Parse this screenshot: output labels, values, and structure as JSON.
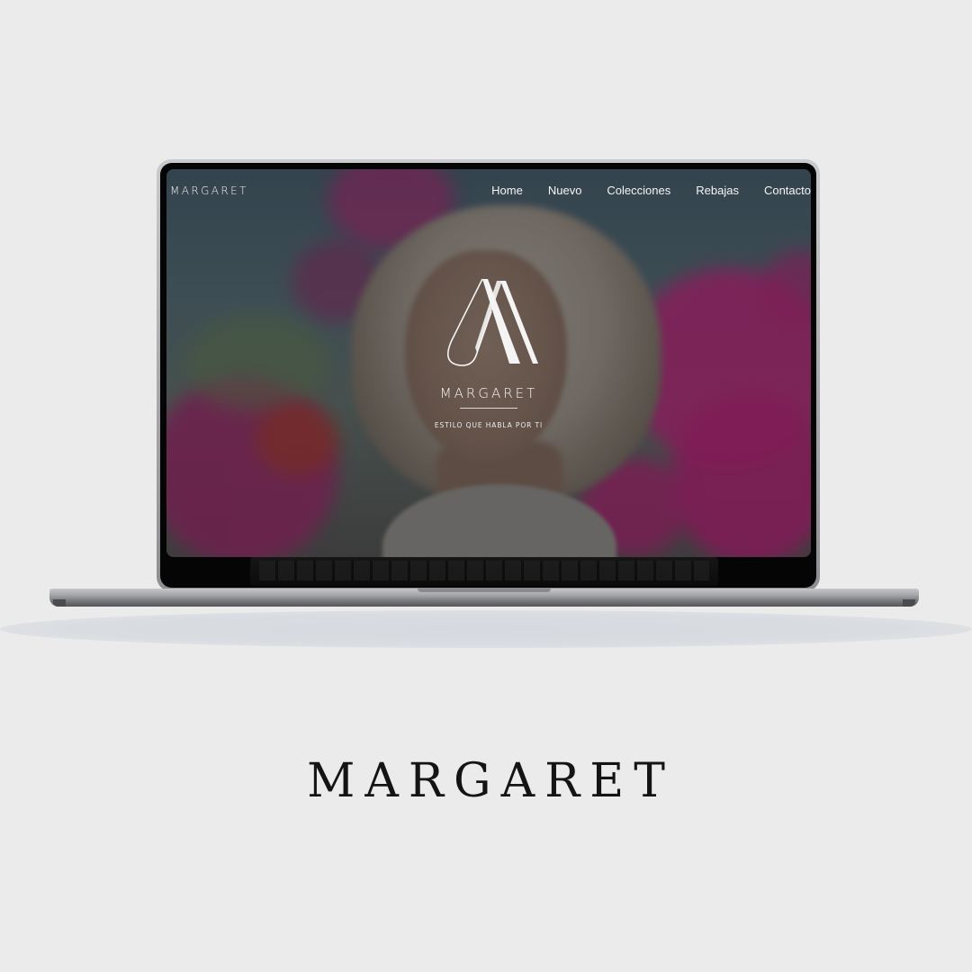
{
  "site": {
    "brand": "MARGARET",
    "nav": {
      "home": "Home",
      "nuevo": "Nuevo",
      "colecciones": "Colecciones",
      "rebajas": "Rebajas",
      "contacto": "Contacto"
    },
    "hero": {
      "brand": "MARGARET",
      "tagline": "ESTILO QUE HABLA POR TI"
    }
  },
  "caption": "MARGARET",
  "colors": {
    "background": "#ebebeb",
    "accent_flowers": "#c0187a",
    "text_light": "#f3f3f3"
  },
  "icons": {
    "logo": "margaret-m-monogram"
  }
}
